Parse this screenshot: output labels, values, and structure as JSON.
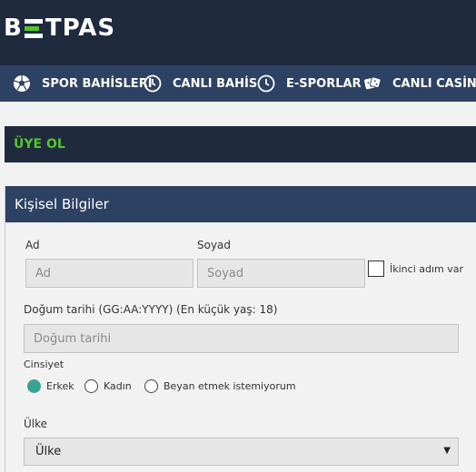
{
  "brand": {
    "logo_left": "B",
    "logo_right": "TPAS"
  },
  "nav": {
    "items": [
      {
        "label": "SPOR BAHİSLERİ",
        "icon": "soccer-ball-icon"
      },
      {
        "label": "CANLI BAHİS",
        "icon": "clock-icon"
      },
      {
        "label": "E-SPORLAR",
        "icon": "clock-icon"
      },
      {
        "label": "CANLI CASİNO",
        "icon": "dice-icon"
      }
    ]
  },
  "section": {
    "title": "ÜYE OL"
  },
  "panel": {
    "title": "Kişisel Bilgiler"
  },
  "form": {
    "first_name": {
      "label": "Ad",
      "placeholder": "Ad"
    },
    "last_name": {
      "label": "Soyad",
      "placeholder": "Soyad"
    },
    "second_name": {
      "label": "İkinci adım var",
      "checked": false
    },
    "birthdate": {
      "label": "Doğum tarihi (GG:AA:YYYY) (En küçük yaş: 18)",
      "placeholder": "Doğum tarihi"
    },
    "gender": {
      "label": "Cinsiyet",
      "options": [
        "Erkek",
        "Kadın",
        "Beyan etmek istemiyorum"
      ],
      "selected": "Erkek"
    },
    "country": {
      "label": "Ülke",
      "value": "Ülke"
    }
  },
  "colors": {
    "header_bg": "#1f2a3f",
    "nav_bg": "#2d4163",
    "accent_green": "#55c52a",
    "radio_selected": "#3aa38f"
  }
}
